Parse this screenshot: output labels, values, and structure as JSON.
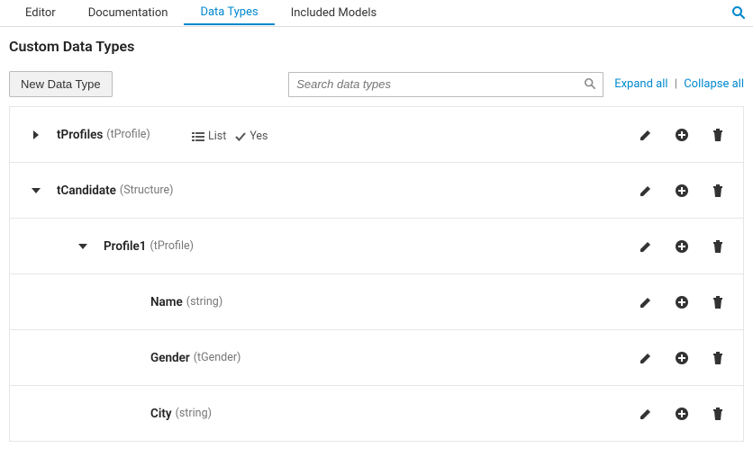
{
  "nav": {
    "tabs": [
      {
        "label": "Editor",
        "active": false
      },
      {
        "label": "Documentation",
        "active": false
      },
      {
        "label": "Data Types",
        "active": true
      },
      {
        "label": "Included Models",
        "active": false
      }
    ]
  },
  "page": {
    "title": "Custom Data Types",
    "newButton": "New Data Type",
    "searchPlaceholder": "Search data types",
    "expandAll": "Expand all",
    "collapseAll": "Collapse all"
  },
  "rows": [
    {
      "indent": 0,
      "chev": "right",
      "name": "tProfiles",
      "paren": "(tProfile)",
      "extraList": "List",
      "extraYes": "Yes"
    },
    {
      "indent": 0,
      "chev": "down",
      "name": "tCandidate",
      "paren": "(Structure)"
    },
    {
      "indent": 1,
      "chev": "down",
      "name": "Profile1",
      "paren": "(tProfile)"
    },
    {
      "indent": 2,
      "chev": "",
      "name": "Name",
      "paren": "(string)"
    },
    {
      "indent": 2,
      "chev": "",
      "name": "Gender",
      "paren": "(tGender)"
    },
    {
      "indent": 2,
      "chev": "",
      "name": "City",
      "paren": "(string)"
    }
  ]
}
